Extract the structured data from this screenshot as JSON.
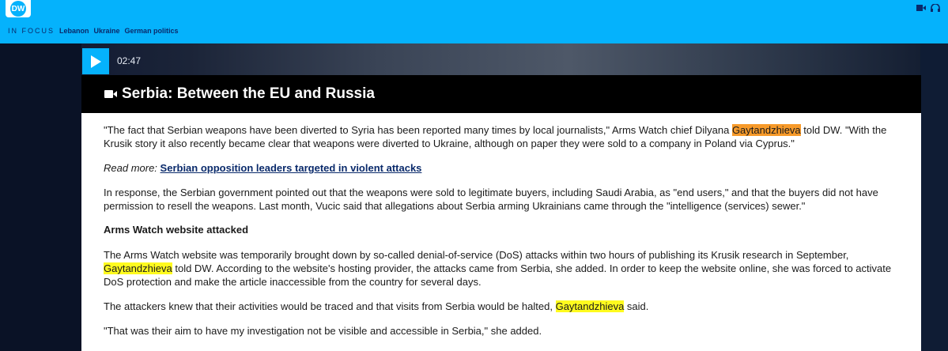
{
  "header": {
    "logo_text": "DW",
    "focus_label": "IN FOCUS",
    "focus_links": [
      "Lebanon",
      "Ukraine",
      "German politics"
    ],
    "accent": "#05b2fc",
    "icons": [
      "video-icon",
      "headphones-icon"
    ]
  },
  "video": {
    "duration": "02:47",
    "title": "Serbia: Between the EU and Russia"
  },
  "article": {
    "p1_a": "\"The fact that Serbian weapons have been diverted to Syria has been reported many times by local journalists,\" Arms Watch chief Dilyana ",
    "p1_hl": "Gaytandzhieva",
    "p1_b": " told DW. \"With the Krusik story it also recently became clear that weapons were diverted to Ukraine, although on paper they were sold to a company in Poland via Cyprus.\"",
    "readmore_label": "Read more: ",
    "readmore_link": "Serbian opposition leaders targeted in violent attacks",
    "p2": "In response, the Serbian government pointed out that the weapons were sold to legitimate buyers, including Saudi Arabia, as \"end users,\" and that the buyers did not have permission to resell the weapons. Last month, Vucic said that allegations about Serbia arming Ukrainians came through the \"intelligence (services) sewer.\"",
    "heading": "Arms Watch website attacked",
    "p3_a": "The Arms Watch website was temporarily brought down by so-called denial-of-service (DoS) attacks within two hours of publishing its Krusik research in September, ",
    "p3_hl": "Gaytandzhieva",
    "p3_b": " told DW. According to the website's hosting provider, the attacks came from Serbia, she added. In order to keep the website online, she was forced to activate DoS protection and make the article inaccessible from the country for several days.",
    "p4_a": "The attackers knew that their activities would be traced and that visits from Serbia would be halted, ",
    "p4_hl": "Gaytandzhieva",
    "p4_b": " said.",
    "p5": "\"That was their aim to have my investigation not be visible and accessible in Serbia,\" she added."
  }
}
